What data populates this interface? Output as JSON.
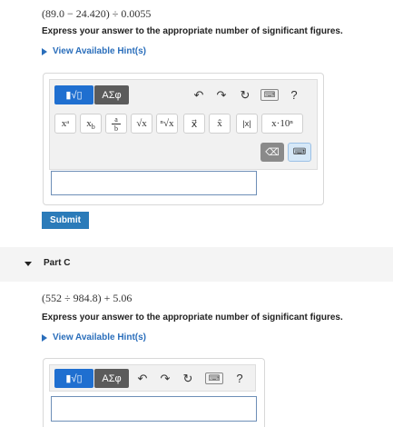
{
  "partB": {
    "expression": "(89.0 − 24.420) ÷ 0.0055",
    "instruction": "Express your answer to the appropriate number of significant figures.",
    "hint_link": "View Available Hint(s)",
    "toolbar": {
      "templates_label": "▮√▯",
      "greek_label": "ΑΣφ",
      "undo_icon": "↶",
      "redo_icon": "↷",
      "reset_icon": "↻",
      "keyboard_icon": "⌨",
      "help_icon": "?"
    },
    "keys": [
      "xᵃ",
      "x_b",
      "a/b",
      "√x",
      "ⁿ√x",
      "x⃗",
      "x̂",
      "|x|",
      "x·10ⁿ"
    ],
    "key_display": {
      "power": "xᵃ",
      "subscript": "x",
      "subscript_b": "b",
      "frac_a": "a",
      "frac_b": "b",
      "sqrt": "√x",
      "nthroot": "ⁿ√x",
      "vector": "x⃗",
      "unit_vector": "x̂",
      "abs": "|x|",
      "sci": "x·10ⁿ"
    },
    "backspace_icon": "⌫",
    "answer_value": "",
    "submit_label": "Submit"
  },
  "partC": {
    "title": "Part C",
    "expression": "(552 ÷ 984.8) + 5.06",
    "instruction": "Express your answer to the appropriate number of significant figures.",
    "hint_link": "View Available Hint(s)",
    "toolbar": {
      "templates_label": "▮√▯",
      "greek_label": "ΑΣφ",
      "undo_icon": "↶",
      "redo_icon": "↷",
      "reset_icon": "↻",
      "keyboard_icon": "⌨",
      "help_icon": "?"
    },
    "answer_value": ""
  },
  "colors": {
    "accent": "#1f6fd0",
    "link": "#2a6ebb",
    "submit": "#2b7bb9",
    "toolbar_dark": "#5b5b5b"
  }
}
